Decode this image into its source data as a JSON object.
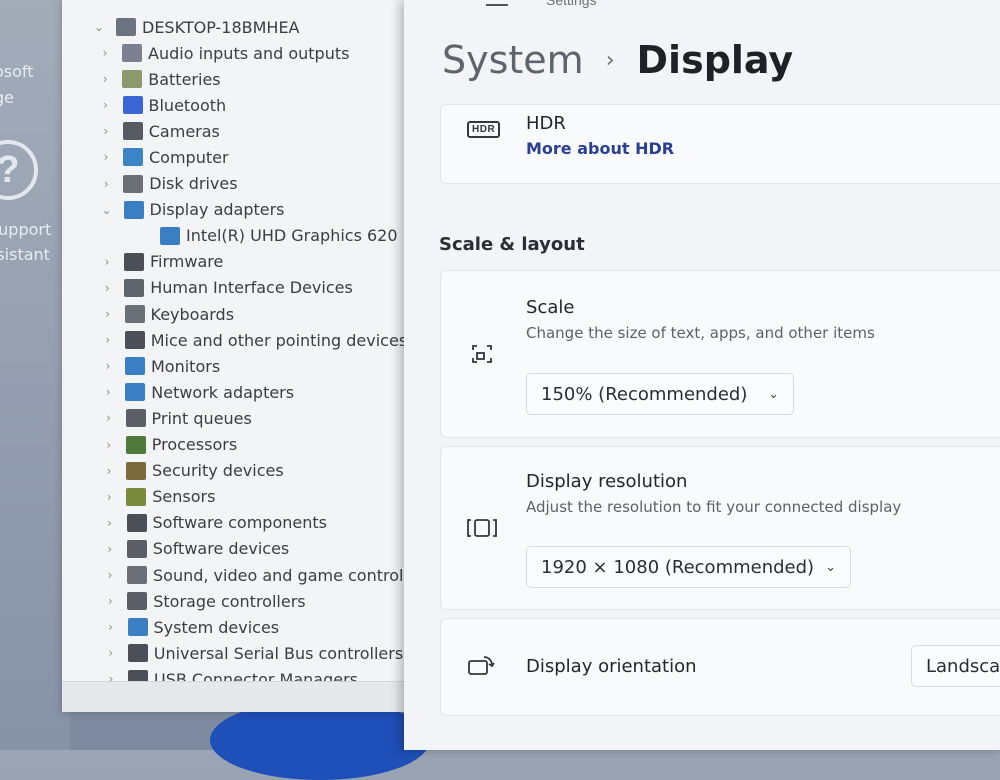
{
  "desktop": {
    "labels": [
      "osoft",
      "ge",
      "Support",
      "ssistant"
    ],
    "help_glyph": "?"
  },
  "device_manager": {
    "computer_name": "DESKTOP-18BMHEA",
    "items": [
      {
        "label": "Audio inputs and outputs",
        "expanded": false,
        "child": false,
        "icon": "speaker-icon",
        "color": "#7b8090"
      },
      {
        "label": "Batteries",
        "expanded": false,
        "child": false,
        "icon": "battery-icon",
        "color": "#8b9a6a"
      },
      {
        "label": "Bluetooth",
        "expanded": false,
        "child": false,
        "icon": "bluetooth-icon",
        "color": "#3a66d6"
      },
      {
        "label": "Cameras",
        "expanded": false,
        "child": false,
        "icon": "camera-icon",
        "color": "#555a63"
      },
      {
        "label": "Computer",
        "expanded": false,
        "child": false,
        "icon": "monitor-icon",
        "color": "#3c84c8"
      },
      {
        "label": "Disk drives",
        "expanded": false,
        "child": false,
        "icon": "disk-icon",
        "color": "#6b7076"
      },
      {
        "label": "Display adapters",
        "expanded": true,
        "child": false,
        "icon": "display-adapter-icon",
        "color": "#3a7fc4"
      },
      {
        "label": "Intel(R) UHD Graphics 620",
        "expanded": false,
        "child": true,
        "icon": "display-adapter-icon",
        "color": "#3a7fc4"
      },
      {
        "label": "Firmware",
        "expanded": false,
        "child": false,
        "icon": "chip-icon",
        "color": "#4b4f56"
      },
      {
        "label": "Human Interface Devices",
        "expanded": false,
        "child": false,
        "icon": "keyboard-icon",
        "color": "#5e646c"
      },
      {
        "label": "Keyboards",
        "expanded": false,
        "child": false,
        "icon": "keyboard-icon",
        "color": "#6a7078"
      },
      {
        "label": "Mice and other pointing devices",
        "expanded": false,
        "child": false,
        "icon": "mouse-icon",
        "color": "#4a4f58"
      },
      {
        "label": "Monitors",
        "expanded": false,
        "child": false,
        "icon": "monitor-icon",
        "color": "#3a7fc4"
      },
      {
        "label": "Network adapters",
        "expanded": false,
        "child": false,
        "icon": "network-icon",
        "color": "#3a7fc4"
      },
      {
        "label": "Print queues",
        "expanded": false,
        "child": false,
        "icon": "printer-icon",
        "color": "#5a5f68"
      },
      {
        "label": "Processors",
        "expanded": false,
        "child": false,
        "icon": "processor-icon",
        "color": "#4e7a3c"
      },
      {
        "label": "Security devices",
        "expanded": false,
        "child": false,
        "icon": "security-icon",
        "color": "#7a6a3c"
      },
      {
        "label": "Sensors",
        "expanded": false,
        "child": false,
        "icon": "sensor-icon",
        "color": "#7a8a3c"
      },
      {
        "label": "Software components",
        "expanded": false,
        "child": false,
        "icon": "component-icon",
        "color": "#4b5058"
      },
      {
        "label": "Software devices",
        "expanded": false,
        "child": false,
        "icon": "device-icon",
        "color": "#5a5f68"
      },
      {
        "label": "Sound, video and game controllers",
        "expanded": false,
        "child": false,
        "icon": "speaker-icon",
        "color": "#6b7078"
      },
      {
        "label": "Storage controllers",
        "expanded": false,
        "child": false,
        "icon": "storage-icon",
        "color": "#5a5f68"
      },
      {
        "label": "System devices",
        "expanded": false,
        "child": false,
        "icon": "monitor-icon",
        "color": "#3a7fc4"
      },
      {
        "label": "Universal Serial Bus controllers",
        "expanded": false,
        "child": false,
        "icon": "usb-icon",
        "color": "#4b5058"
      },
      {
        "label": "USB Connector Managers",
        "expanded": false,
        "child": false,
        "icon": "usb-icon",
        "color": "#4b5058"
      }
    ]
  },
  "settings": {
    "app_title": "Settings",
    "breadcrumb": {
      "parent": "System",
      "separator": "›",
      "current": "Display"
    },
    "hdr": {
      "badge": "HDR",
      "title": "HDR",
      "link": "More about HDR"
    },
    "section_heading": "Scale & layout",
    "scale": {
      "title": "Scale",
      "subtitle": "Change the size of text, apps, and other items",
      "value": "150% (Recommended)"
    },
    "resolution": {
      "title": "Display resolution",
      "subtitle": "Adjust the resolution to fit your connected display",
      "value": "1920 × 1080 (Recommended)"
    },
    "orientation": {
      "title": "Display orientation",
      "value": "Landscape"
    },
    "caret": "⌄"
  }
}
